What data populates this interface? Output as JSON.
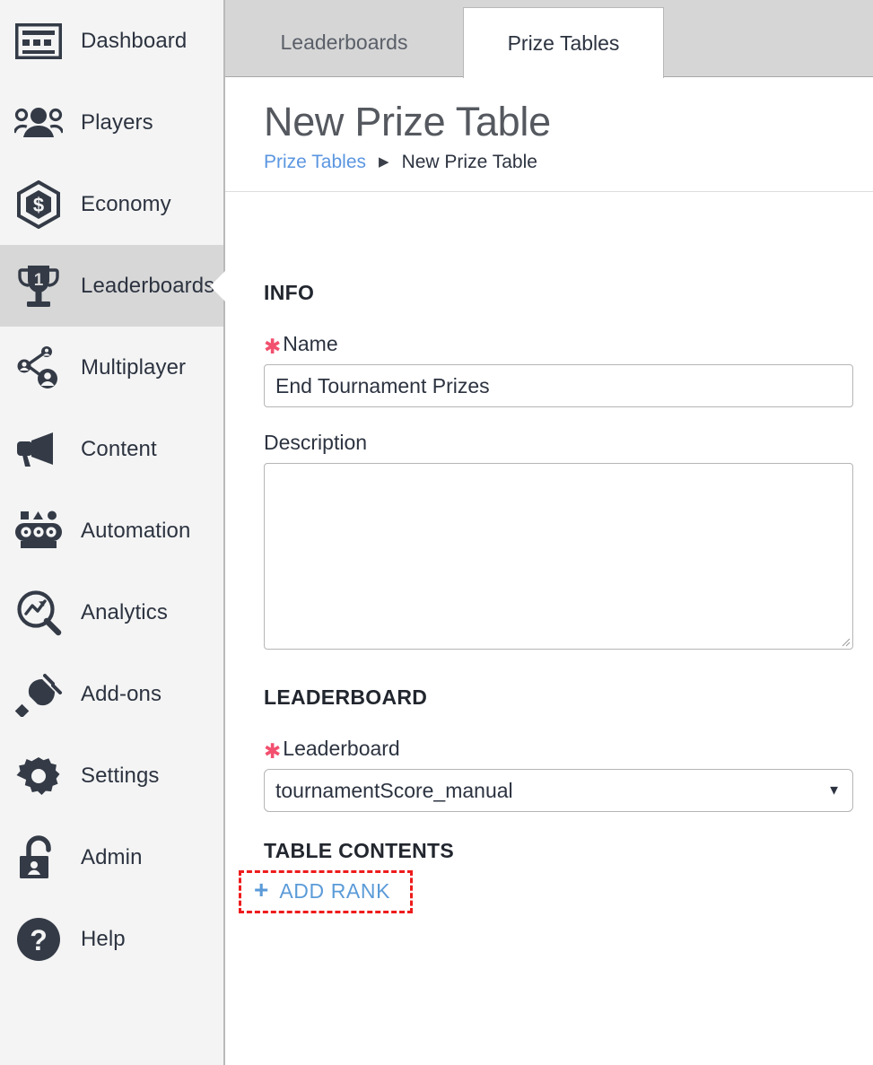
{
  "sidebar": {
    "items": [
      {
        "label": "Dashboard",
        "icon": "dashboard-icon",
        "active": false
      },
      {
        "label": "Players",
        "icon": "players-icon",
        "active": false
      },
      {
        "label": "Economy",
        "icon": "economy-icon",
        "active": false
      },
      {
        "label": "Leaderboards",
        "icon": "trophy-icon",
        "active": true
      },
      {
        "label": "Multiplayer",
        "icon": "multiplayer-icon",
        "active": false
      },
      {
        "label": "Content",
        "icon": "megaphone-icon",
        "active": false
      },
      {
        "label": "Automation",
        "icon": "automation-icon",
        "active": false
      },
      {
        "label": "Analytics",
        "icon": "analytics-icon",
        "active": false
      },
      {
        "label": "Add-ons",
        "icon": "plug-icon",
        "active": false
      },
      {
        "label": "Settings",
        "icon": "gear-icon",
        "active": false
      },
      {
        "label": "Admin",
        "icon": "lock-icon",
        "active": false
      },
      {
        "label": "Help",
        "icon": "question-icon",
        "active": false
      }
    ]
  },
  "tabs": [
    {
      "label": "Leaderboards",
      "active": false
    },
    {
      "label": "Prize Tables",
      "active": true
    }
  ],
  "header": {
    "title": "New Prize Table",
    "breadcrumb": {
      "link": "Prize Tables",
      "separator": "▶",
      "current": "New Prize Table"
    }
  },
  "form": {
    "info": {
      "heading": "INFO",
      "name": {
        "label": "Name",
        "required_marker": "✱",
        "value": "End Tournament Prizes",
        "placeholder": ""
      },
      "description": {
        "label": "Description",
        "value": "",
        "placeholder": ""
      }
    },
    "leaderboard": {
      "heading": "LEADERBOARD",
      "field": {
        "label": "Leaderboard",
        "required_marker": "✱",
        "value": "tournamentScore_manual",
        "caret": "▼"
      }
    },
    "table_contents": {
      "heading": "TABLE CONTENTS",
      "add_rank": {
        "plus": "+",
        "label": "ADD RANK"
      }
    }
  },
  "colors": {
    "accent_blue": "#5b9bd8",
    "link_blue": "#5b96e0",
    "required_red": "#f2506e",
    "annotation_red": "#ee1c1c",
    "sidebar_bg": "#f4f4f4",
    "sidebar_active_bg": "#d7d7d7",
    "tabbar_bg": "#d6d6d6",
    "text_dark": "#2c3340"
  }
}
